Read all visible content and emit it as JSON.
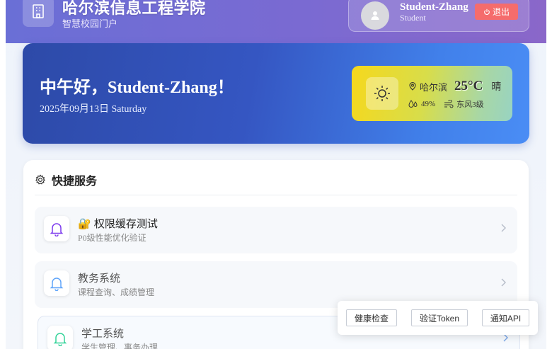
{
  "header": {
    "school_name": "哈尔滨信息工程学院",
    "portal_subtitle": "智慧校园门户",
    "user_name": "Student-Zhang",
    "user_role": "Student",
    "logout_label": "退出"
  },
  "welcome": {
    "greeting": "中午好，Student-Zhang！",
    "date": "2025年09月13日 Saturday"
  },
  "weather": {
    "city": "哈尔滨",
    "temperature": "25°C",
    "condition": "晴",
    "humidity": "49%",
    "wind": "东风3级"
  },
  "services": {
    "title": "快捷服务",
    "items": [
      {
        "title": "🔐 权限缓存测试",
        "desc": "P0级性能优化验证",
        "icon_color": "#7c3aed"
      },
      {
        "title": "教务系统",
        "desc": "课程查询、成绩管理",
        "icon_color": "#60a5fa"
      },
      {
        "title": "学工系统",
        "desc": "学生管理、事务办理",
        "icon_color": "#34d399"
      }
    ]
  },
  "api_panel": {
    "health": "健康检查",
    "token": "验证Token",
    "notify": "通知API"
  },
  "colors": {
    "header": "#7a6ad2",
    "banner": "#3556c2",
    "logout": "#f56c6c"
  }
}
